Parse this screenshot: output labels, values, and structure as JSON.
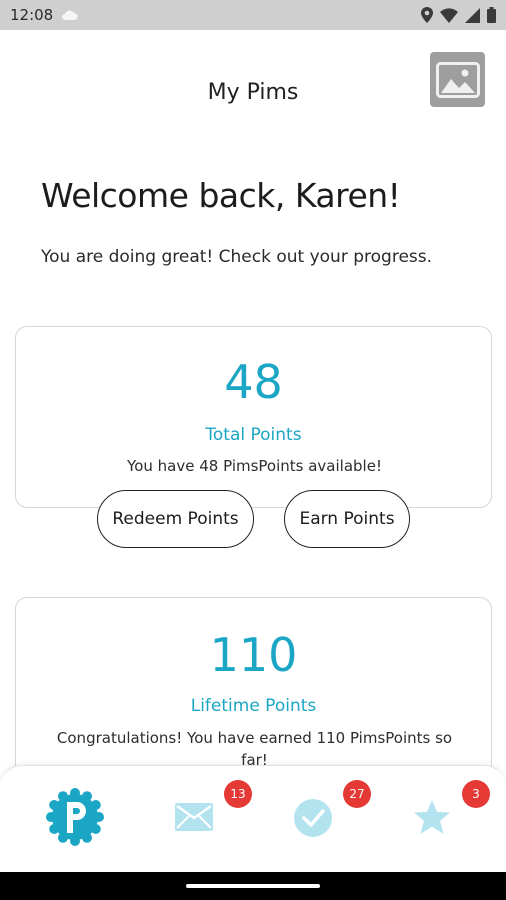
{
  "status_bar": {
    "time": "12:08",
    "icons": [
      "cloud-icon",
      "location-icon",
      "wifi-icon",
      "signal-icon",
      "battery-icon"
    ]
  },
  "header": {
    "title": "My Pims",
    "image_icon": "image-placeholder-icon"
  },
  "welcome": {
    "heading": "Welcome back, Karen!",
    "subtitle": "You are doing great! Check out your progress."
  },
  "total_card": {
    "value": "48",
    "label": "Total Points",
    "description": "You have 48 PimsPoints available!"
  },
  "actions": {
    "redeem_label": "Redeem Points",
    "earn_label": "Earn Points"
  },
  "lifetime_card": {
    "value": "110",
    "label": "Lifetime Points",
    "description": "Congratulations! You have earned 110 PimsPoints so far!"
  },
  "bottom_nav": {
    "items": [
      {
        "icon": "pims-logo-icon",
        "badge": ""
      },
      {
        "icon": "mail-icon",
        "badge": "13"
      },
      {
        "icon": "check-circle-icon",
        "badge": "27"
      },
      {
        "icon": "star-icon",
        "badge": "3"
      }
    ]
  },
  "colors": {
    "accent": "#1aa6c4",
    "inactive_icon": "#b3e3ee",
    "badge": "#e53935",
    "status_bar": "#cfcfcf"
  }
}
